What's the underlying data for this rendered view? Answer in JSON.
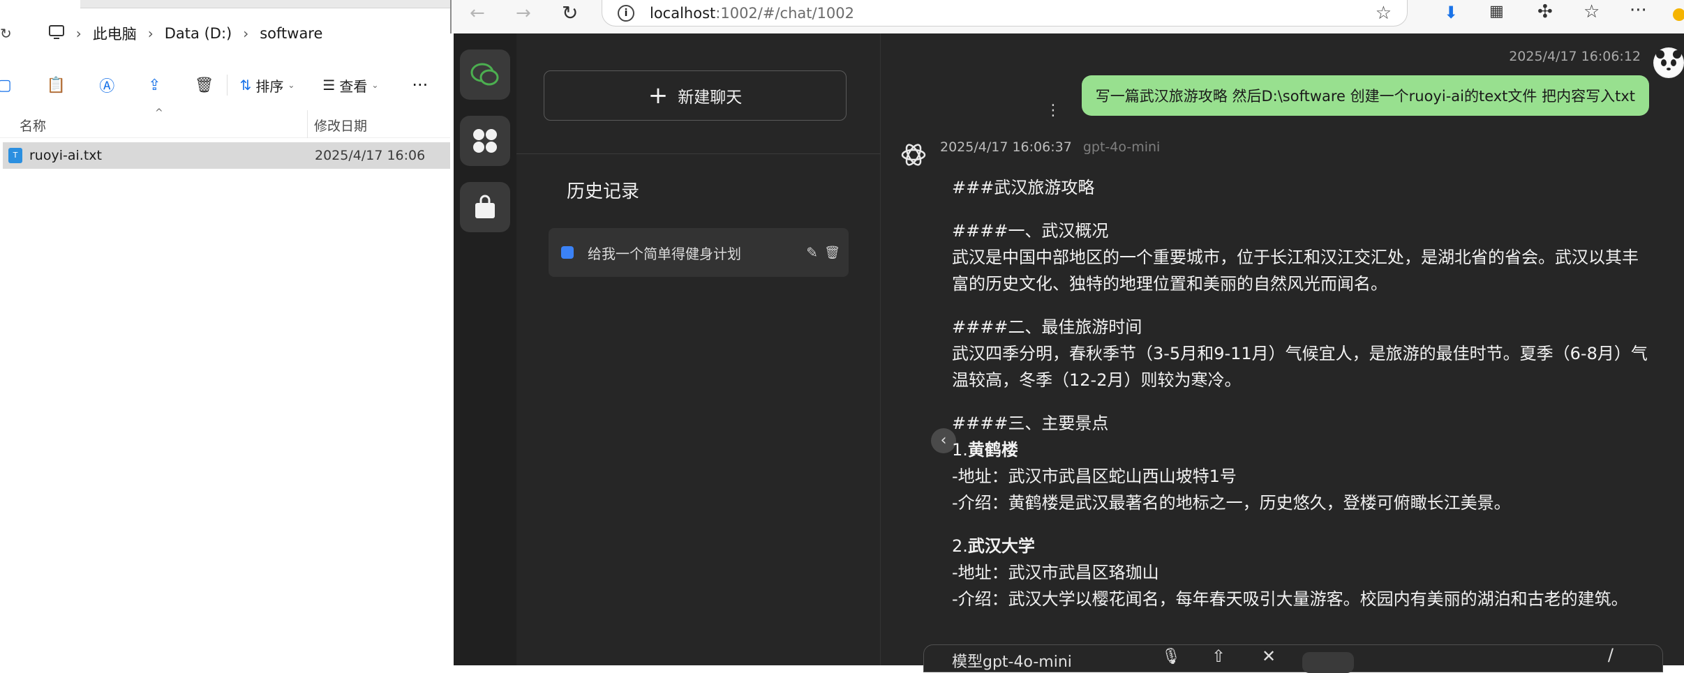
{
  "explorer": {
    "breadcrumb": [
      "此电脑",
      "Data (D:)",
      "software"
    ],
    "toolbar": {
      "sort": "排序",
      "view": "查看"
    },
    "columns": {
      "name": "名称",
      "modified": "修改日期"
    },
    "file": {
      "name": "ruoyi-ai.txt",
      "modified": "2025/4/17 16:06"
    }
  },
  "browser": {
    "url_host": "localhost",
    "url_path": ":1002/#/chat/1002"
  },
  "sidebar": {
    "new_chat": "新建聊天",
    "history_title": "历史记录",
    "history_items": [
      {
        "label": "给我一个简单得健身计划"
      }
    ]
  },
  "chat": {
    "user_time": "2025/4/17 16:06:12",
    "user_message": "写一篇武汉旅游攻略 然后D:\\software 创建一个ruoyi-ai的text文件  把内容写入txt",
    "bot_time": "2025/4/17 16:06:37",
    "bot_model": "gpt-4o-mini",
    "bot": {
      "h1": "###武汉旅游攻略",
      "s1_title": "####一、武汉概况",
      "s1_body": "武汉是中国中部地区的一个重要城市，位于长江和汉江交汇处，是湖北省的省会。武汉以其丰富的历史文化、独特的地理位置和美丽的自然风光而闻名。",
      "s2_title": "####二、最佳旅游时间",
      "s2_body": "武汉四季分明，春秋季节（3-5月和9-11月）气候宜人，是旅游的最佳时节。夏季（6-8月）气温较高，冬季（12-2月）则较为寒冷。",
      "s3_title": "####三、主要景点",
      "spot1_num": "1.",
      "spot1_name": "黄鹤楼",
      "spot1_addr": "-地址：武汉市武昌区蛇山西山坡特1号",
      "spot1_desc": "-介绍：黄鹤楼是武汉最著名的地标之一，历史悠久，登楼可俯瞰长江美景。",
      "spot2_num": "2.",
      "spot2_name": "武汉大学",
      "spot2_addr": "-地址：武汉市武昌区珞珈山",
      "spot2_desc": "-介绍：武汉大学以樱花闻名，每年春天吸引大量游客。校园内有美丽的湖泊和古老的建筑。"
    }
  },
  "input": {
    "model_label": "模型gpt-4o-mini"
  },
  "colors": {
    "user_bubble": "#98e08f",
    "accent_green": "#4caf50",
    "history_dot": "#3b82f6"
  }
}
